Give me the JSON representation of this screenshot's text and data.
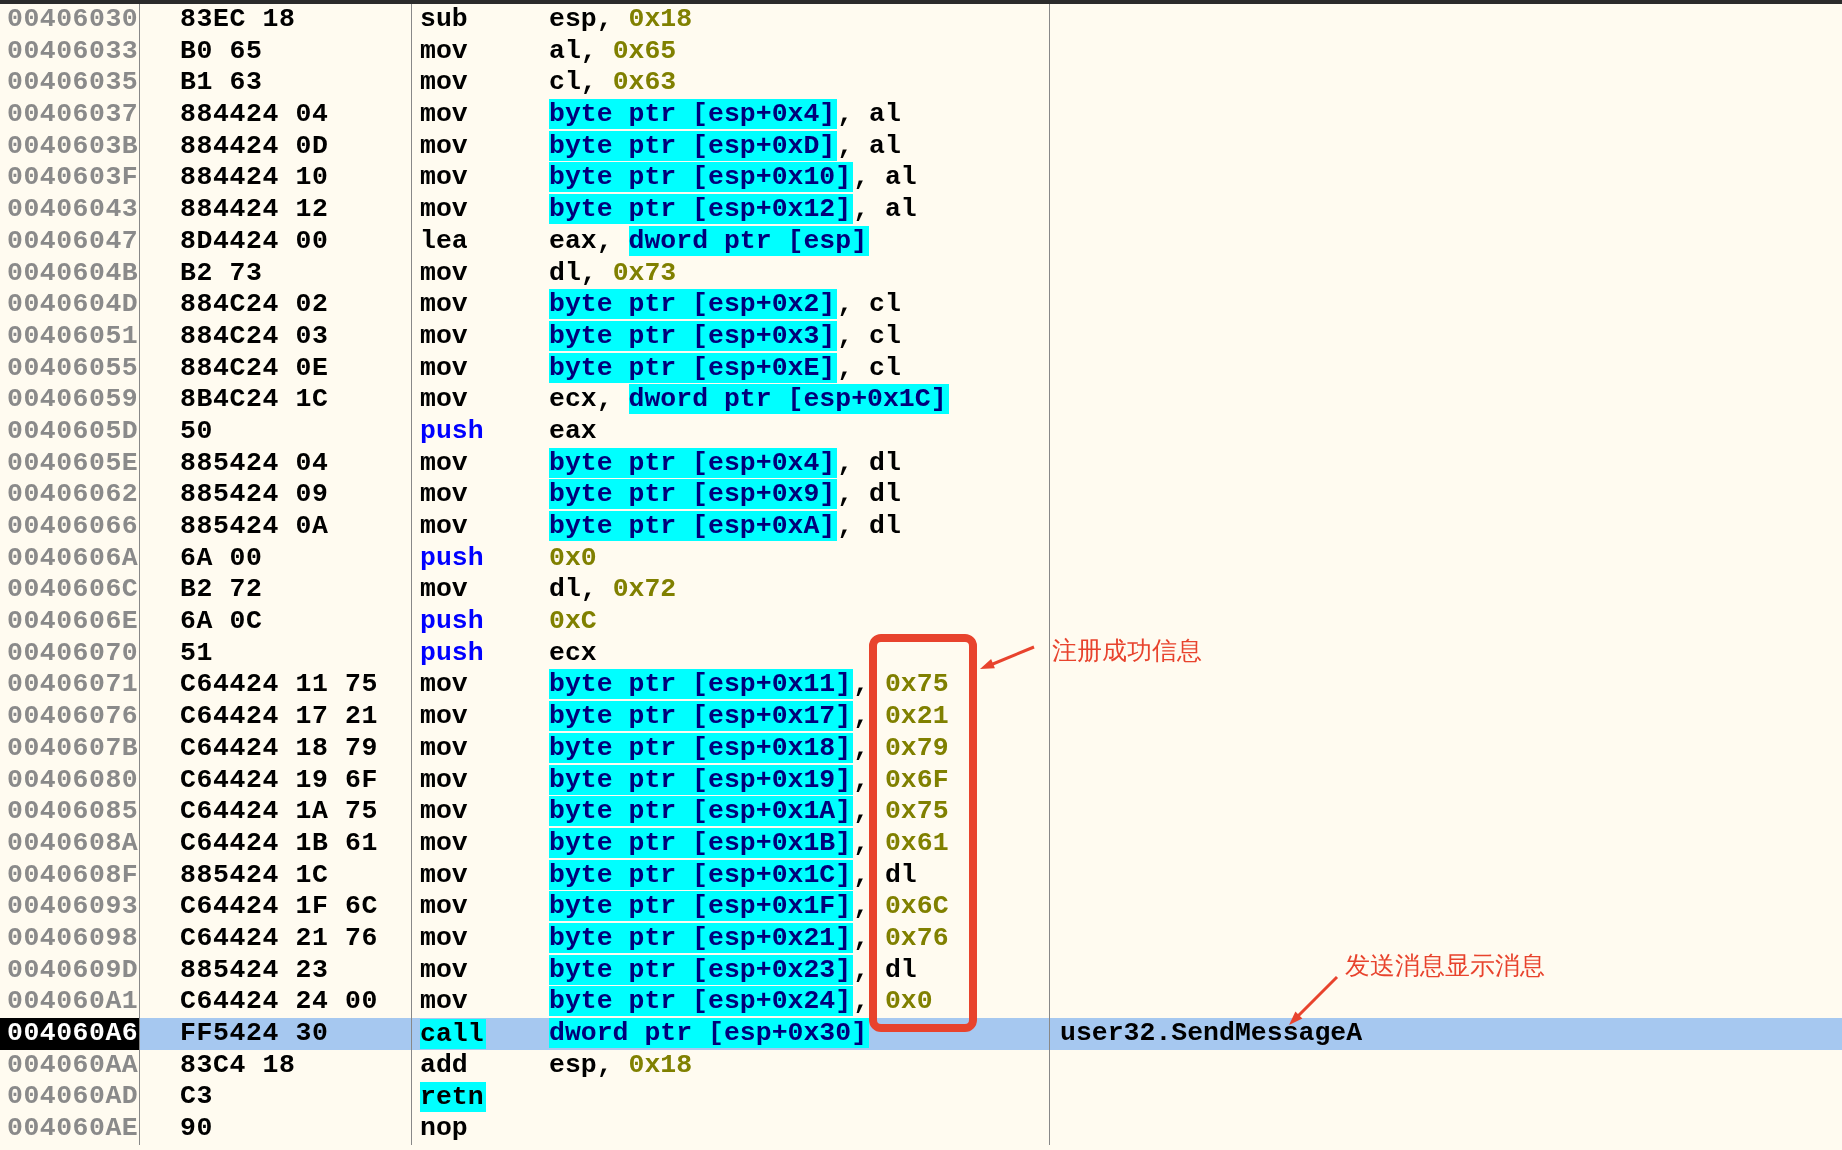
{
  "rows": [
    {
      "address": "00406030",
      "hex": "83EC 18",
      "mnemonic": {
        "text": "sub",
        "kind": "plain"
      },
      "operands": [
        {
          "text": "esp, ",
          "kind": "plain"
        },
        {
          "text": "0x18",
          "kind": "imm"
        }
      ],
      "selected": false
    },
    {
      "address": "00406033",
      "hex": "B0 65",
      "mnemonic": {
        "text": "mov",
        "kind": "plain"
      },
      "operands": [
        {
          "text": "al, ",
          "kind": "plain"
        },
        {
          "text": "0x65",
          "kind": "imm"
        }
      ],
      "selected": false
    },
    {
      "address": "00406035",
      "hex": "B1 63",
      "mnemonic": {
        "text": "mov",
        "kind": "plain"
      },
      "operands": [
        {
          "text": "cl, ",
          "kind": "plain"
        },
        {
          "text": "0x63",
          "kind": "imm"
        }
      ],
      "selected": false
    },
    {
      "address": "00406037",
      "hex": "884424 04",
      "mnemonic": {
        "text": "mov",
        "kind": "plain"
      },
      "operands": [
        {
          "text": "byte ptr [esp+0x4]",
          "kind": "mem"
        },
        {
          "text": ", al",
          "kind": "plain"
        }
      ],
      "selected": false
    },
    {
      "address": "0040603B",
      "hex": "884424 0D",
      "mnemonic": {
        "text": "mov",
        "kind": "plain"
      },
      "operands": [
        {
          "text": "byte ptr [esp+0xD]",
          "kind": "mem"
        },
        {
          "text": ", al",
          "kind": "plain"
        }
      ],
      "selected": false
    },
    {
      "address": "0040603F",
      "hex": "884424 10",
      "mnemonic": {
        "text": "mov",
        "kind": "plain"
      },
      "operands": [
        {
          "text": "byte ptr [esp+0x10]",
          "kind": "mem"
        },
        {
          "text": ", al",
          "kind": "plain"
        }
      ],
      "selected": false
    },
    {
      "address": "00406043",
      "hex": "884424 12",
      "mnemonic": {
        "text": "mov",
        "kind": "plain"
      },
      "operands": [
        {
          "text": "byte ptr [esp+0x12]",
          "kind": "mem"
        },
        {
          "text": ", al",
          "kind": "plain"
        }
      ],
      "selected": false
    },
    {
      "address": "00406047",
      "hex": "8D4424 00",
      "mnemonic": {
        "text": "lea",
        "kind": "plain"
      },
      "operands": [
        {
          "text": "eax, ",
          "kind": "plain"
        },
        {
          "text": "dword ptr [esp]",
          "kind": "mem"
        }
      ],
      "selected": false
    },
    {
      "address": "0040604B",
      "hex": "B2 73",
      "mnemonic": {
        "text": "mov",
        "kind": "plain"
      },
      "operands": [
        {
          "text": "dl, ",
          "kind": "plain"
        },
        {
          "text": "0x73",
          "kind": "imm"
        }
      ],
      "selected": false
    },
    {
      "address": "0040604D",
      "hex": "884C24 02",
      "mnemonic": {
        "text": "mov",
        "kind": "plain"
      },
      "operands": [
        {
          "text": "byte ptr [esp+0x2]",
          "kind": "mem"
        },
        {
          "text": ", cl",
          "kind": "plain"
        }
      ],
      "selected": false
    },
    {
      "address": "00406051",
      "hex": "884C24 03",
      "mnemonic": {
        "text": "mov",
        "kind": "plain"
      },
      "operands": [
        {
          "text": "byte ptr [esp+0x3]",
          "kind": "mem"
        },
        {
          "text": ", cl",
          "kind": "plain"
        }
      ],
      "selected": false
    },
    {
      "address": "00406055",
      "hex": "884C24 0E",
      "mnemonic": {
        "text": "mov",
        "kind": "plain"
      },
      "operands": [
        {
          "text": "byte ptr [esp+0xE]",
          "kind": "mem"
        },
        {
          "text": ", cl",
          "kind": "plain"
        }
      ],
      "selected": false
    },
    {
      "address": "00406059",
      "hex": "8B4C24 1C",
      "mnemonic": {
        "text": "mov",
        "kind": "plain"
      },
      "operands": [
        {
          "text": "ecx, ",
          "kind": "plain"
        },
        {
          "text": "dword ptr [esp+0x1C]",
          "kind": "mem"
        }
      ],
      "selected": false
    },
    {
      "address": "0040605D",
      "hex": "50",
      "mnemonic": {
        "text": "push",
        "kind": "push"
      },
      "operands": [
        {
          "text": "eax",
          "kind": "plain"
        }
      ],
      "selected": false
    },
    {
      "address": "0040605E",
      "hex": "885424 04",
      "mnemonic": {
        "text": "mov",
        "kind": "plain"
      },
      "operands": [
        {
          "text": "byte ptr [esp+0x4]",
          "kind": "mem"
        },
        {
          "text": ", dl",
          "kind": "plain"
        }
      ],
      "selected": false
    },
    {
      "address": "00406062",
      "hex": "885424 09",
      "mnemonic": {
        "text": "mov",
        "kind": "plain"
      },
      "operands": [
        {
          "text": "byte ptr [esp+0x9]",
          "kind": "mem"
        },
        {
          "text": ", dl",
          "kind": "plain"
        }
      ],
      "selected": false
    },
    {
      "address": "00406066",
      "hex": "885424 0A",
      "mnemonic": {
        "text": "mov",
        "kind": "plain"
      },
      "operands": [
        {
          "text": "byte ptr [esp+0xA]",
          "kind": "mem"
        },
        {
          "text": ", dl",
          "kind": "plain"
        }
      ],
      "selected": false
    },
    {
      "address": "0040606A",
      "hex": "6A 00",
      "mnemonic": {
        "text": "push",
        "kind": "push"
      },
      "operands": [
        {
          "text": "0x0",
          "kind": "imm"
        }
      ],
      "selected": false
    },
    {
      "address": "0040606C",
      "hex": "B2 72",
      "mnemonic": {
        "text": "mov",
        "kind": "plain"
      },
      "operands": [
        {
          "text": "dl, ",
          "kind": "plain"
        },
        {
          "text": "0x72",
          "kind": "imm"
        }
      ],
      "selected": false
    },
    {
      "address": "0040606E",
      "hex": "6A 0C",
      "mnemonic": {
        "text": "push",
        "kind": "push"
      },
      "operands": [
        {
          "text": "0xC",
          "kind": "imm"
        }
      ],
      "selected": false
    },
    {
      "address": "00406070",
      "hex": "51",
      "mnemonic": {
        "text": "push",
        "kind": "push"
      },
      "operands": [
        {
          "text": "ecx",
          "kind": "plain"
        }
      ],
      "selected": false
    },
    {
      "address": "00406071",
      "hex": "C64424 11 75",
      "mnemonic": {
        "text": "mov",
        "kind": "plain"
      },
      "operands": [
        {
          "text": "byte ptr [esp+0x11]",
          "kind": "mem"
        },
        {
          "text": ", ",
          "kind": "plain"
        },
        {
          "text": "0x75",
          "kind": "imm"
        }
      ],
      "selected": false
    },
    {
      "address": "00406076",
      "hex": "C64424 17 21",
      "mnemonic": {
        "text": "mov",
        "kind": "plain"
      },
      "operands": [
        {
          "text": "byte ptr [esp+0x17]",
          "kind": "mem"
        },
        {
          "text": ", ",
          "kind": "plain"
        },
        {
          "text": "0x21",
          "kind": "imm"
        }
      ],
      "selected": false
    },
    {
      "address": "0040607B",
      "hex": "C64424 18 79",
      "mnemonic": {
        "text": "mov",
        "kind": "plain"
      },
      "operands": [
        {
          "text": "byte ptr [esp+0x18]",
          "kind": "mem"
        },
        {
          "text": ", ",
          "kind": "plain"
        },
        {
          "text": "0x79",
          "kind": "imm"
        }
      ],
      "selected": false
    },
    {
      "address": "00406080",
      "hex": "C64424 19 6F",
      "mnemonic": {
        "text": "mov",
        "kind": "plain"
      },
      "operands": [
        {
          "text": "byte ptr [esp+0x19]",
          "kind": "mem"
        },
        {
          "text": ", ",
          "kind": "plain"
        },
        {
          "text": "0x6F",
          "kind": "imm"
        }
      ],
      "selected": false
    },
    {
      "address": "00406085",
      "hex": "C64424 1A 75",
      "mnemonic": {
        "text": "mov",
        "kind": "plain"
      },
      "operands": [
        {
          "text": "byte ptr [esp+0x1A]",
          "kind": "mem"
        },
        {
          "text": ", ",
          "kind": "plain"
        },
        {
          "text": "0x75",
          "kind": "imm"
        }
      ],
      "selected": false
    },
    {
      "address": "0040608A",
      "hex": "C64424 1B 61",
      "mnemonic": {
        "text": "mov",
        "kind": "plain"
      },
      "operands": [
        {
          "text": "byte ptr [esp+0x1B]",
          "kind": "mem"
        },
        {
          "text": ", ",
          "kind": "plain"
        },
        {
          "text": "0x61",
          "kind": "imm"
        }
      ],
      "selected": false
    },
    {
      "address": "0040608F",
      "hex": "885424 1C",
      "mnemonic": {
        "text": "mov",
        "kind": "plain"
      },
      "operands": [
        {
          "text": "byte ptr [esp+0x1C]",
          "kind": "mem"
        },
        {
          "text": ", dl",
          "kind": "plain"
        }
      ],
      "selected": false
    },
    {
      "address": "00406093",
      "hex": "C64424 1F 6C",
      "mnemonic": {
        "text": "mov",
        "kind": "plain"
      },
      "operands": [
        {
          "text": "byte ptr [esp+0x1F]",
          "kind": "mem"
        },
        {
          "text": ", ",
          "kind": "plain"
        },
        {
          "text": "0x6C",
          "kind": "imm"
        }
      ],
      "selected": false
    },
    {
      "address": "00406098",
      "hex": "C64424 21 76",
      "mnemonic": {
        "text": "mov",
        "kind": "plain"
      },
      "operands": [
        {
          "text": "byte ptr [esp+0x21]",
          "kind": "mem"
        },
        {
          "text": ", ",
          "kind": "plain"
        },
        {
          "text": "0x76",
          "kind": "imm"
        }
      ],
      "selected": false
    },
    {
      "address": "0040609D",
      "hex": "885424 23",
      "mnemonic": {
        "text": "mov",
        "kind": "plain"
      },
      "operands": [
        {
          "text": "byte ptr [esp+0x23]",
          "kind": "mem"
        },
        {
          "text": ", dl",
          "kind": "plain"
        }
      ],
      "selected": false
    },
    {
      "address": "004060A1",
      "hex": "C64424 24 00",
      "mnemonic": {
        "text": "mov",
        "kind": "plain"
      },
      "operands": [
        {
          "text": "byte ptr [esp+0x24]",
          "kind": "mem"
        },
        {
          "text": ", ",
          "kind": "plain"
        },
        {
          "text": "0x0",
          "kind": "imm"
        }
      ],
      "selected": false
    },
    {
      "address": "004060A6",
      "hex": "FF5424 30",
      "mnemonic": {
        "text": "call",
        "kind": "hl"
      },
      "operands": [
        {
          "text": "dword ptr [esp+0x30]",
          "kind": "mem"
        }
      ],
      "comment": "user32.SendMessageA",
      "selected": true
    },
    {
      "address": "004060AA",
      "hex": "83C4 18",
      "mnemonic": {
        "text": "add",
        "kind": "plain"
      },
      "operands": [
        {
          "text": "esp, ",
          "kind": "plain"
        },
        {
          "text": "0x18",
          "kind": "imm"
        }
      ],
      "selected": false
    },
    {
      "address": "004060AD",
      "hex": "C3",
      "mnemonic": {
        "text": "retn",
        "kind": "hl"
      },
      "selected": false
    },
    {
      "address": "004060AE",
      "hex": "90",
      "mnemonic": {
        "text": "nop",
        "kind": "plain"
      },
      "selected": false
    }
  ],
  "annotations": [
    {
      "kind": "box"
    },
    {
      "kind": "callout",
      "text": "注册成功信息"
    },
    {
      "kind": "callout",
      "text": "发送消息显示消息"
    }
  ]
}
